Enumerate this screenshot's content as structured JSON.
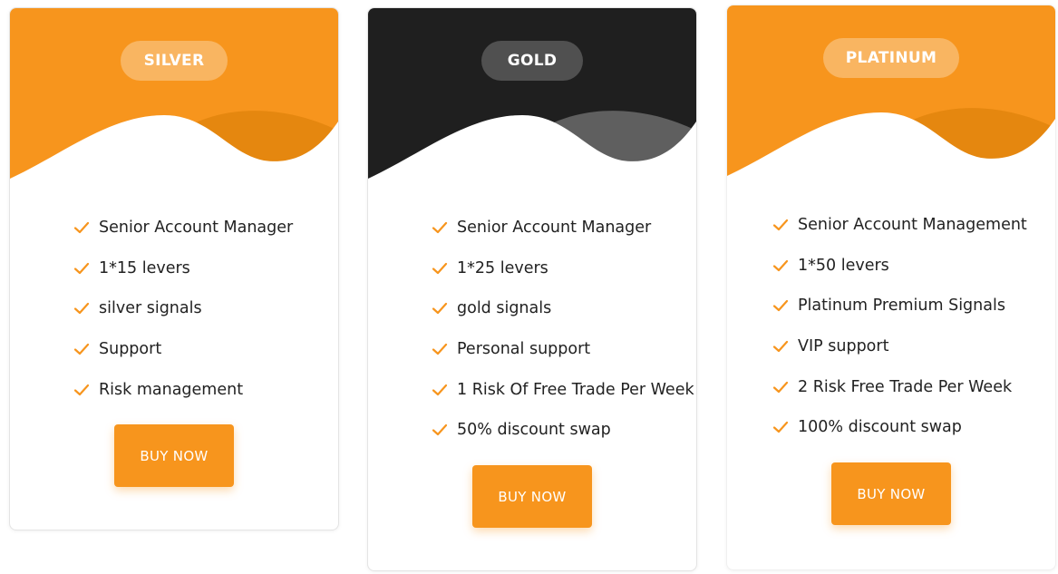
{
  "colors": {
    "accent": "#f7951d",
    "accent_dark": "#e5870f",
    "gold_header": "#1f1f1f",
    "gold_wave": "#5f5f5f",
    "check": "#f7951d",
    "text": "#222222"
  },
  "plans": [
    {
      "name": "SILVER",
      "features": [
        "Senior Account Manager",
        "1*15 levers",
        "silver signals",
        "Support",
        "Risk management"
      ],
      "button_label": "BUY NOW"
    },
    {
      "name": "GOLD",
      "features": [
        "Senior Account Manager",
        "1*25 levers",
        "gold signals",
        "Personal support",
        "1 Risk Of Free Trade Per Week",
        "50% discount swap"
      ],
      "button_label": "BUY NOW"
    },
    {
      "name": "PLATINUM",
      "features": [
        "Senior Account Management",
        "1*50 levers",
        "Platinum Premium Signals",
        "VIP support",
        "2 Risk Free Trade Per Week",
        "100% discount swap"
      ],
      "button_label": "BUY NOW"
    }
  ]
}
